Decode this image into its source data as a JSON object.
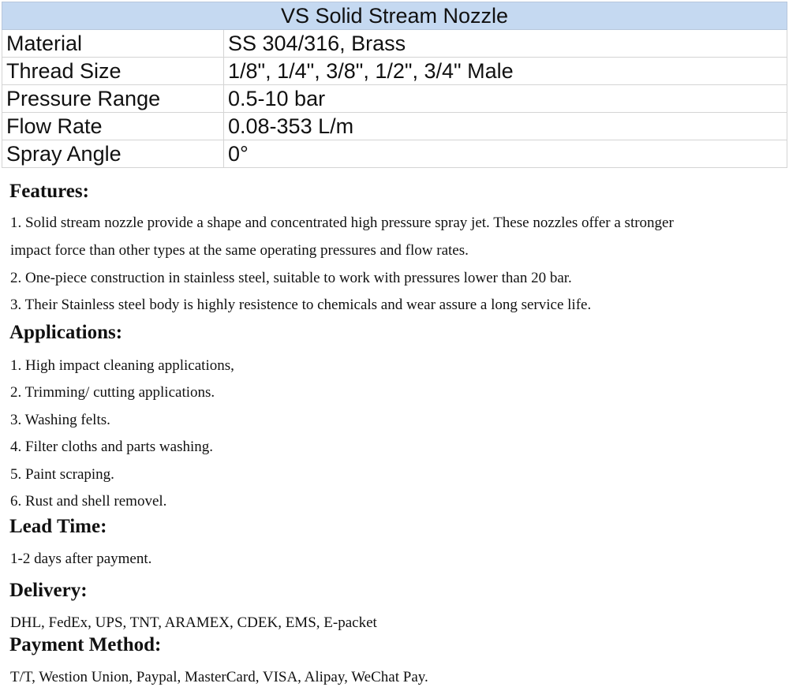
{
  "table": {
    "title": "VS Solid Stream Nozzle",
    "rows": [
      {
        "label": "Material",
        "value": "SS 304/316, Brass"
      },
      {
        "label": "Thread Size",
        "value": "1/8\", 1/4\", 3/8\", 1/2\", 3/4\" Male"
      },
      {
        "label": "Pressure Range",
        "value": "0.5-10 bar"
      },
      {
        "label": "Flow Rate",
        "value": "0.08-353 L/m"
      },
      {
        "label": "Spray Angle",
        "value": "0°"
      }
    ]
  },
  "features": {
    "title": "Features:",
    "lines": [
      "1. Solid stream nozzle provide a shape and concentrated high pressure spray jet. These nozzles offer a stronger",
      "impact force than other types at the same operating pressures and flow rates.",
      "2. One-piece construction in stainless steel, suitable to work with pressures lower than 20 bar.",
      "3. Their Stainless steel body is highly resistence to chemicals and wear assure a long service life."
    ]
  },
  "applications": {
    "title": "Applications:",
    "lines": [
      "1. High impact cleaning applications,",
      "2. Trimming/ cutting applications.",
      "3. Washing felts.",
      "4. Filter cloths and parts washing.",
      "5. Paint scraping.",
      "6. Rust and shell removel."
    ]
  },
  "lead_time": {
    "title": "Lead Time:",
    "lines": [
      "1-2 days after payment."
    ]
  },
  "delivery": {
    "title": "Delivery:",
    "lines": [
      "DHL, FedEx, UPS, TNT, ARAMEX, CDEK, EMS, E-packet"
    ]
  },
  "payment": {
    "title": "Payment Method:",
    "lines": [
      "T/T, Westion Union, Paypal, MasterCard, VISA, Alipay, WeChat Pay."
    ]
  }
}
